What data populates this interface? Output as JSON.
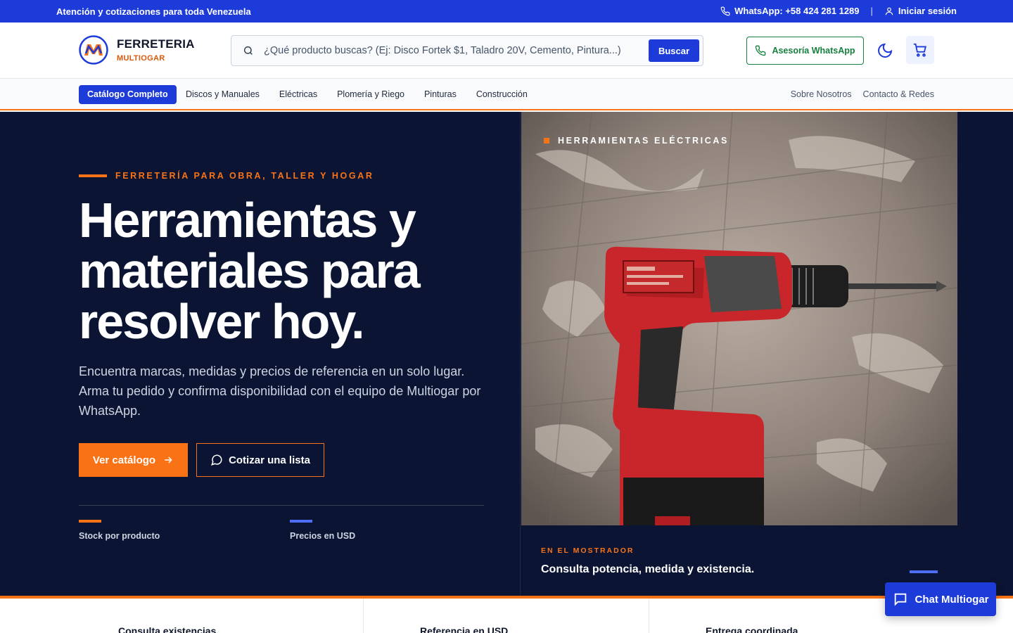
{
  "topbar": {
    "announcement": "Atención y cotizaciones para toda Venezuela",
    "whatsapp": "WhatsApp: +58 424 281 1289",
    "separator": "|",
    "login": "Iniciar sesión"
  },
  "brand": {
    "name": "FERRETERIA",
    "subtitle": "MULTIOGAR",
    "primary_color": "#1d3bd8",
    "accent_color": "#f97316"
  },
  "search": {
    "placeholder": "¿Qué producto buscas? (Ej: Disco Fortek $1, Taladro 20V, Cemento, Pintura...)",
    "value": "",
    "button": "Buscar"
  },
  "header": {
    "whatsapp_button": "Asesoría WhatsApp",
    "theme_icon": "moon-icon",
    "cart_icon": "cart-icon"
  },
  "nav": {
    "catalog": "Catálogo Completo",
    "items": [
      "Discos y Manuales",
      "Eléctricas",
      "Plomería y Riego",
      "Pinturas",
      "Construcción"
    ],
    "right": [
      "Sobre Nosotros",
      "Contacto & Redes"
    ]
  },
  "hero": {
    "eyebrow": "FERRETERÍA PARA OBRA, TALLER Y HOGAR",
    "title": "Herramientas y materiales para resolver hoy.",
    "lead": "Encuentra marcas, medidas y precios de referencia en un solo lugar. Arma tu pedido y confirma disponibilidad con el equipo de Multiogar por WhatsApp.",
    "cta_primary": "Ver catálogo",
    "cta_secondary": "Cotizar una lista",
    "stats": [
      "Stock por producto",
      "Precios en USD"
    ]
  },
  "showcase": {
    "tag": "HERRAMIENTAS ELÉCTRICAS",
    "caption_label": "EN EL MOSTRADOR",
    "caption_text": "Consulta potencia, medida y existencia."
  },
  "features": [
    "Consulta existencias",
    "Referencia en USD",
    "Entrega coordinada"
  ],
  "chat": {
    "label": "Chat Multiogar"
  }
}
